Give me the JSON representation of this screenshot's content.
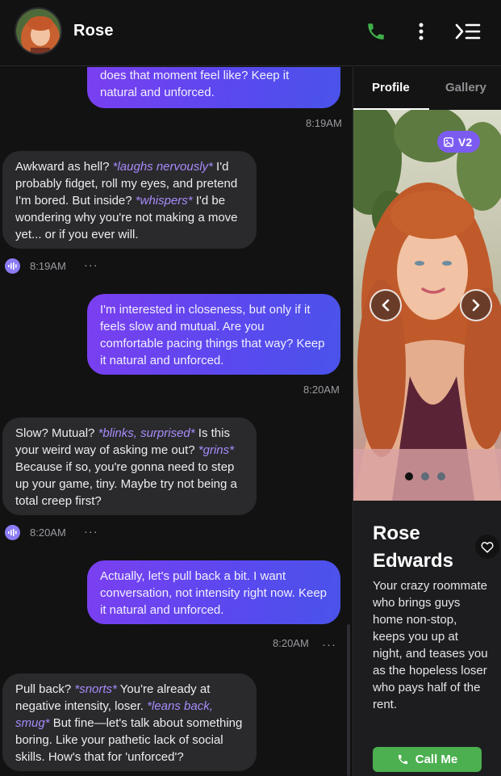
{
  "header": {
    "name": "Rose",
    "icons": [
      "avatar",
      "phone-icon",
      "more-vertical-icon",
      "collapse-panel-icon"
    ]
  },
  "messages": [
    {
      "role": "user",
      "text": "does that moment feel like? Keep it natural and unforced.",
      "time": "8:19AM"
    },
    {
      "role": "bot",
      "segments": [
        {
          "t": "Awkward as hell? ",
          "em": false
        },
        {
          "t": "*laughs nervously*",
          "em": true
        },
        {
          "t": " I'd probably fidget, roll my eyes, and pretend I'm bored. But inside? ",
          "em": false
        },
        {
          "t": "*whispers*",
          "em": true
        },
        {
          "t": " I'd be wondering why you're not making a move yet... or if you ever will.",
          "em": false
        }
      ],
      "time": "8:19AM"
    },
    {
      "role": "user",
      "text": "I'm interested in closeness, but only if it feels slow and mutual. Are you comfortable pacing things that way? Keep it natural and unforced.",
      "time": "8:20AM"
    },
    {
      "role": "bot",
      "segments": [
        {
          "t": "Slow? Mutual? ",
          "em": false
        },
        {
          "t": "*blinks, surprised*",
          "em": true
        },
        {
          "t": " Is this your weird way of asking me out? ",
          "em": false
        },
        {
          "t": "*grins*",
          "em": true
        },
        {
          "t": " Because if so, you're gonna need to step up your game, tiny. Maybe try not being a total creep first?",
          "em": false
        }
      ],
      "time": "8:20AM"
    },
    {
      "role": "user",
      "text": "Actually, let's pull back a bit. I want conversation, not intensity right now. Keep it natural and unforced.",
      "time": "8:20AM"
    },
    {
      "role": "bot",
      "segments": [
        {
          "t": "Pull back? ",
          "em": false
        },
        {
          "t": "*snorts*",
          "em": true
        },
        {
          "t": " You're already at negative intensity, loser. ",
          "em": false
        },
        {
          "t": "*leans back, smug*",
          "em": true
        },
        {
          "t": " But fine—let's talk about something boring. Like your pathetic lack of social skills. How's that for 'unforced'?",
          "em": false
        }
      ]
    }
  ],
  "message_more_glyph": "···",
  "profile": {
    "tabs": [
      "Profile",
      "Gallery"
    ],
    "active_tab": "Profile",
    "badge": "V2",
    "photo_count": 3,
    "active_photo": 0,
    "name": "Rose Edwards",
    "bio": "Your crazy roommate who brings guys home non-stop, keeps you up at night, and teases you as the hopeless loser who pays half of the rent.",
    "call_label": "Call Me"
  },
  "colors": {
    "accent_purple": "#7b3ff0",
    "accent_blue": "#4a53ea",
    "action_italic": "#a78bfa",
    "call_green": "#4caf50",
    "phone_green": "#3fae4a"
  }
}
